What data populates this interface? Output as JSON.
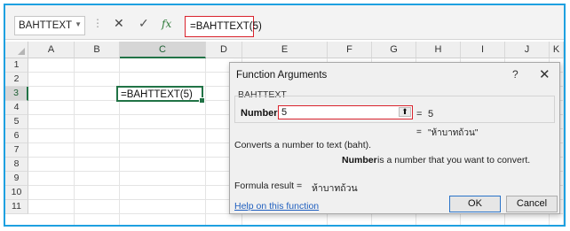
{
  "formula_bar": {
    "name_box": "BAHTTEXT",
    "name_dropdown_icon": "chevron-down",
    "dots": "⋮",
    "cancel_icon": "✕",
    "enter_icon": "✓",
    "fx_label": "fx",
    "formula": "=BAHTTEXT(5)"
  },
  "grid": {
    "columns": [
      "A",
      "B",
      "C",
      "D",
      "E",
      "F",
      "G",
      "H",
      "I",
      "J",
      "K"
    ],
    "rows": [
      "1",
      "2",
      "3",
      "4",
      "5",
      "6",
      "7",
      "8",
      "9",
      "10",
      "11"
    ],
    "selected_column": "C",
    "selected_row": "3",
    "active_cell_text": "=BAHTTEXT(5)"
  },
  "dialog": {
    "title": "Function Arguments",
    "help_button": "?",
    "close_button": "✕",
    "group_label": "BAHTTEXT",
    "argument_label": "Number",
    "argument_value": "5",
    "ref_icon": "collapse-dialog-icon",
    "equals_1": "=",
    "argument_result": "5",
    "equals_2": "=",
    "function_result": "\"ห้าบาทถ้วน\"",
    "description": "Converts a number to text (baht).",
    "argument_name_bold": "Number",
    "argument_description": "is a number that you want to convert.",
    "formula_result_label": "Formula result =",
    "formula_result_value": "ห้าบาทถ้วน",
    "help_link": "Help on this function",
    "ok_label": "OK",
    "cancel_label": "Cancel"
  },
  "colors": {
    "frame_border": "#1ea0e0",
    "highlight_red": "#d9232d",
    "excel_green": "#217346",
    "link_blue": "#1f5fbf"
  }
}
